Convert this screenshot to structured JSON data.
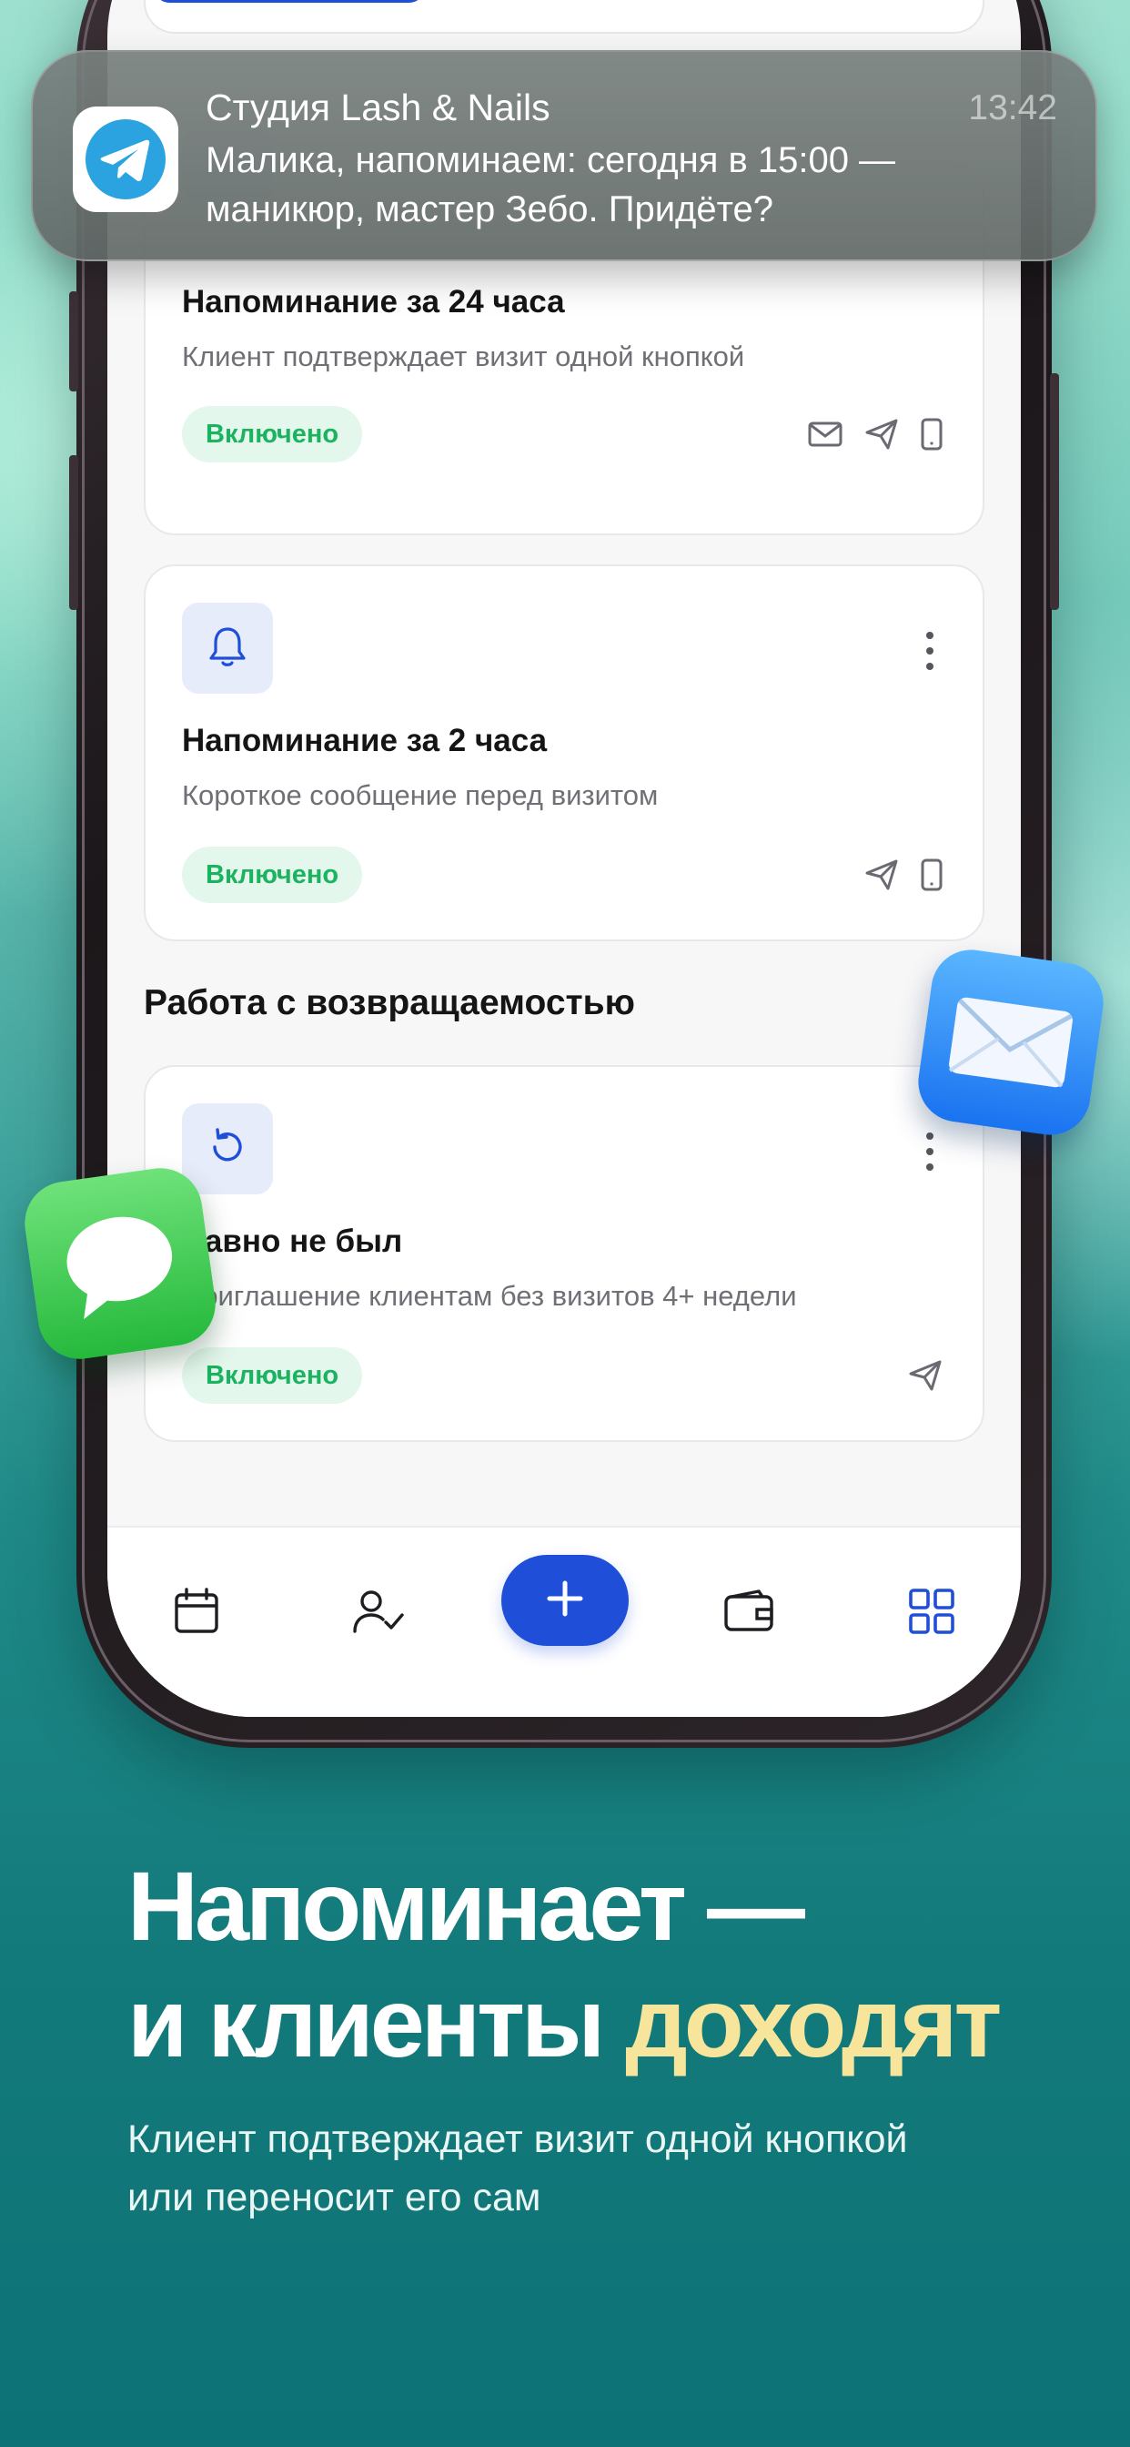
{
  "notification": {
    "title": "Студия Lash & Nails",
    "time": "13:42",
    "body": "Малика, напоминаем: сегодня в 15:00 — маникюр, мастер Зебо. Придёте?"
  },
  "cards": [
    {
      "title": "Напоминание за 24 часа",
      "description": "Клиент подтверждает визит одной кнопкой",
      "status": "Включено",
      "channels": [
        "mail-icon",
        "send-icon",
        "phone-icon"
      ]
    },
    {
      "title": "Напоминание за 2 часа",
      "description": "Короткое сообщение перед визитом",
      "status": "Включено",
      "channels": [
        "send-icon",
        "phone-icon"
      ],
      "icon": "bell-icon"
    },
    {
      "title": "Давно не был",
      "description": "Приглашение клиентам без визитов 4+ недели",
      "status": "Включено",
      "channels": [
        "send-icon"
      ],
      "icon": "refresh-icon"
    }
  ],
  "section_title": "Работа с возвращаемостью",
  "bottom_nav": [
    "calendar-icon",
    "clients-icon",
    "plus-icon",
    "wallet-icon",
    "grid-icon"
  ],
  "headline": {
    "line1": "Напоминает —",
    "line2_white": "и клиенты",
    "line2_accent": "доходят"
  },
  "subline": "Клиент подтверждает визит одной кнопкой или переносит его сам",
  "colors": {
    "accent_blue": "#1f4fd8",
    "badge_green": "#1bb260",
    "headline_accent": "#f6e59a"
  }
}
